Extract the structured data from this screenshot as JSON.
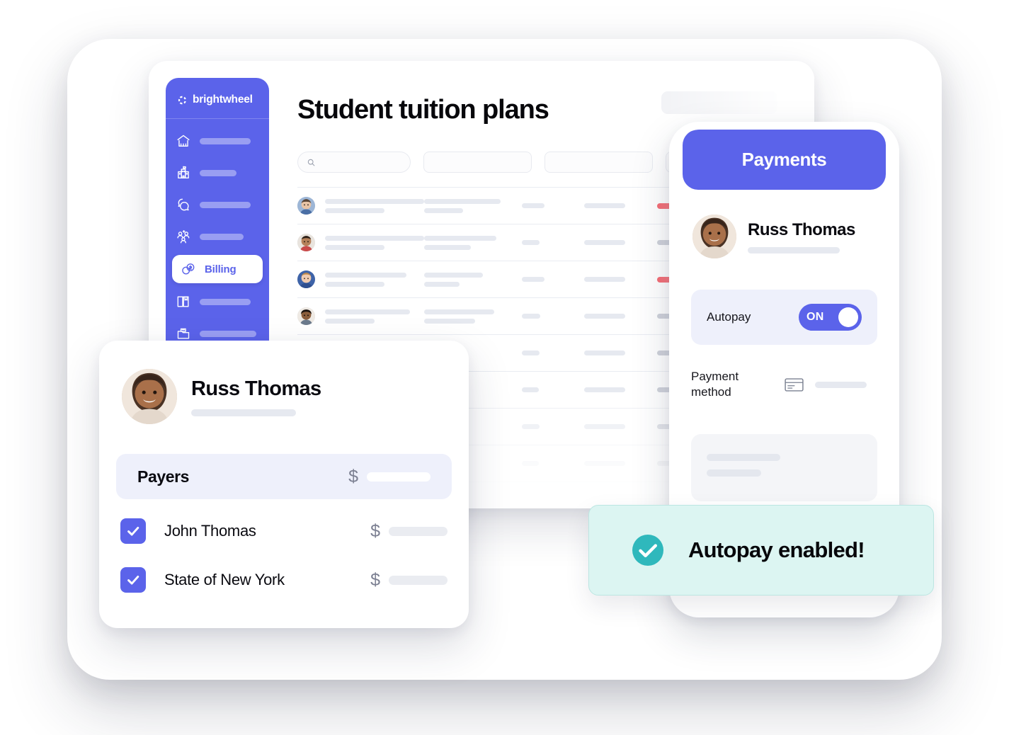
{
  "desktop": {
    "brand": {
      "name": "brightwheel",
      "logo_icon": "brightwheel-pinwheel-icon"
    },
    "sidebar": {
      "items": [
        {
          "icon": "home-icon",
          "label": ""
        },
        {
          "icon": "school-building-icon",
          "label": ""
        },
        {
          "icon": "chat-bubbles-icon",
          "label": ""
        },
        {
          "icon": "people-add-icon",
          "label": ""
        },
        {
          "icon": "coins-dollar-icon",
          "label": "Billing",
          "active": true
        },
        {
          "icon": "book-icon",
          "label": ""
        },
        {
          "icon": "folder-icon",
          "label": ""
        },
        {
          "icon": "bar-chart-icon",
          "label": ""
        }
      ]
    },
    "page_title": "Student tuition plans",
    "search": {
      "icon": "search-icon",
      "value": "",
      "placeholder": ""
    },
    "filters": [
      "",
      "",
      ""
    ],
    "top_action": "",
    "table": {
      "rows": [
        {
          "avatar": "child-avatar-1",
          "status": "overdue"
        },
        {
          "avatar": "child-avatar-2",
          "status": "neutral"
        },
        {
          "avatar": "child-avatar-3",
          "status": "overdue"
        },
        {
          "avatar": "child-avatar-4",
          "status": "neutral"
        },
        {
          "avatar": "",
          "status": "neutral"
        },
        {
          "avatar": "",
          "status": "neutral"
        },
        {
          "avatar": "",
          "status": "neutral"
        },
        {
          "avatar": "",
          "status": "neutral"
        }
      ]
    }
  },
  "phone": {
    "header_title": "Payments",
    "profile": {
      "name": "Russ Thomas",
      "avatar": "child-avatar-russ",
      "subtitle": ""
    },
    "autopay": {
      "label": "Autopay",
      "toggle_state": "ON",
      "enabled": true
    },
    "payment_method": {
      "label": "Payment method",
      "icon": "credit-card-icon",
      "value": ""
    },
    "detail_card": {
      "line1": "",
      "line2": ""
    }
  },
  "payers_card": {
    "profile": {
      "name": "Russ Thomas",
      "avatar": "child-avatar-russ",
      "subtitle": ""
    },
    "header": {
      "title": "Payers",
      "currency": "$",
      "amount": ""
    },
    "rows": [
      {
        "checked": true,
        "name": "John Thomas",
        "currency": "$",
        "amount": ""
      },
      {
        "checked": true,
        "name": "State of New York",
        "currency": "$",
        "amount": ""
      }
    ]
  },
  "toast": {
    "icon": "check-circle-icon",
    "message": "Autopay enabled!",
    "background": "#DCF5F2",
    "icon_color": "#2FB8BC"
  },
  "colors": {
    "brand_purple": "#5B63EA",
    "status_overdue": "#F4555F",
    "status_neutral": "#C7CAD4",
    "toast_teal": "#2FB8BC",
    "panel_lavender": "#EEF0FB"
  }
}
